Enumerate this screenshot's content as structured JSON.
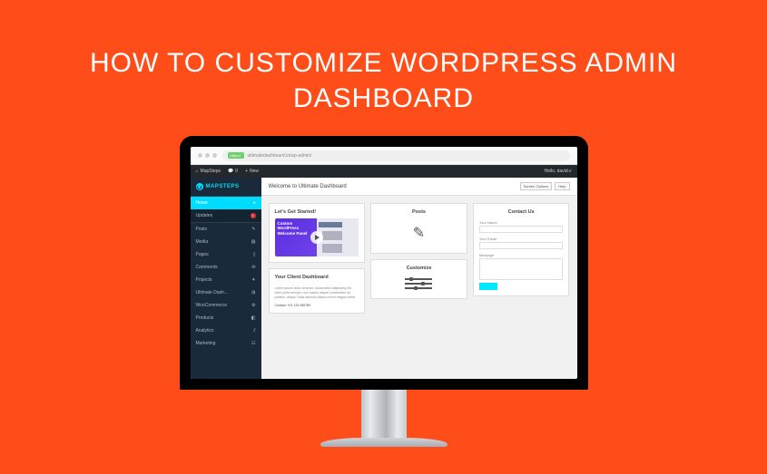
{
  "hero": {
    "title": "HOW TO CUSTOMIZE WORDPRESS ADMIN DASHBOARD"
  },
  "browser": {
    "https_label": "https://",
    "url": "ultimatedashboard.io/wp-admin/"
  },
  "adminbar": {
    "site_name": "MapSteps",
    "comments_count": "0",
    "new_label": "New",
    "greeting": "Hello, david.v"
  },
  "sidebar": {
    "brand": "MAPSTEPS",
    "items": [
      {
        "label": "Home",
        "icon": "home-icon"
      },
      {
        "label": "Updates",
        "icon": "update-icon",
        "badge": "1"
      }
    ],
    "menu": [
      {
        "label": "Posts",
        "icon": "pin-icon"
      },
      {
        "label": "Media",
        "icon": "media-icon"
      },
      {
        "label": "Pages",
        "icon": "page-icon"
      },
      {
        "label": "Comments",
        "icon": "comment-icon"
      },
      {
        "label": "Projects",
        "icon": "project-icon"
      },
      {
        "label": "Ultimate Dash...",
        "icon": "dash-icon"
      },
      {
        "label": "WooCommerce",
        "icon": "woo-icon"
      },
      {
        "label": "Products",
        "icon": "product-icon"
      },
      {
        "label": "Analytics",
        "icon": "analytics-icon"
      },
      {
        "label": "Marketing",
        "icon": "marketing-icon"
      }
    ]
  },
  "content": {
    "page_title": "Welcome to Ultimate Dashboard",
    "screen_options": "Screen Options",
    "help": "Help"
  },
  "widgets": {
    "get_started": {
      "title": "Let's Get Started!",
      "video_text": "Custom WordPress Welcome Panel"
    },
    "client": {
      "title": "Your Client Dashboard",
      "body": "Lorem ipsum dolor sit amet, consectetur adipiscing elit. Idem porta semper, non mauris aliquet consectetur sit porttitor, aliqua. Nulla laborum aliqua minim magna lorem.",
      "contact": "Contact: +01 123 456789"
    },
    "posts": {
      "title": "Posts"
    },
    "customize": {
      "title": "Customize"
    },
    "contact": {
      "title": "Contact Us",
      "name_label": "Your Name",
      "email_label": "Your Email",
      "message_label": "Message"
    }
  }
}
